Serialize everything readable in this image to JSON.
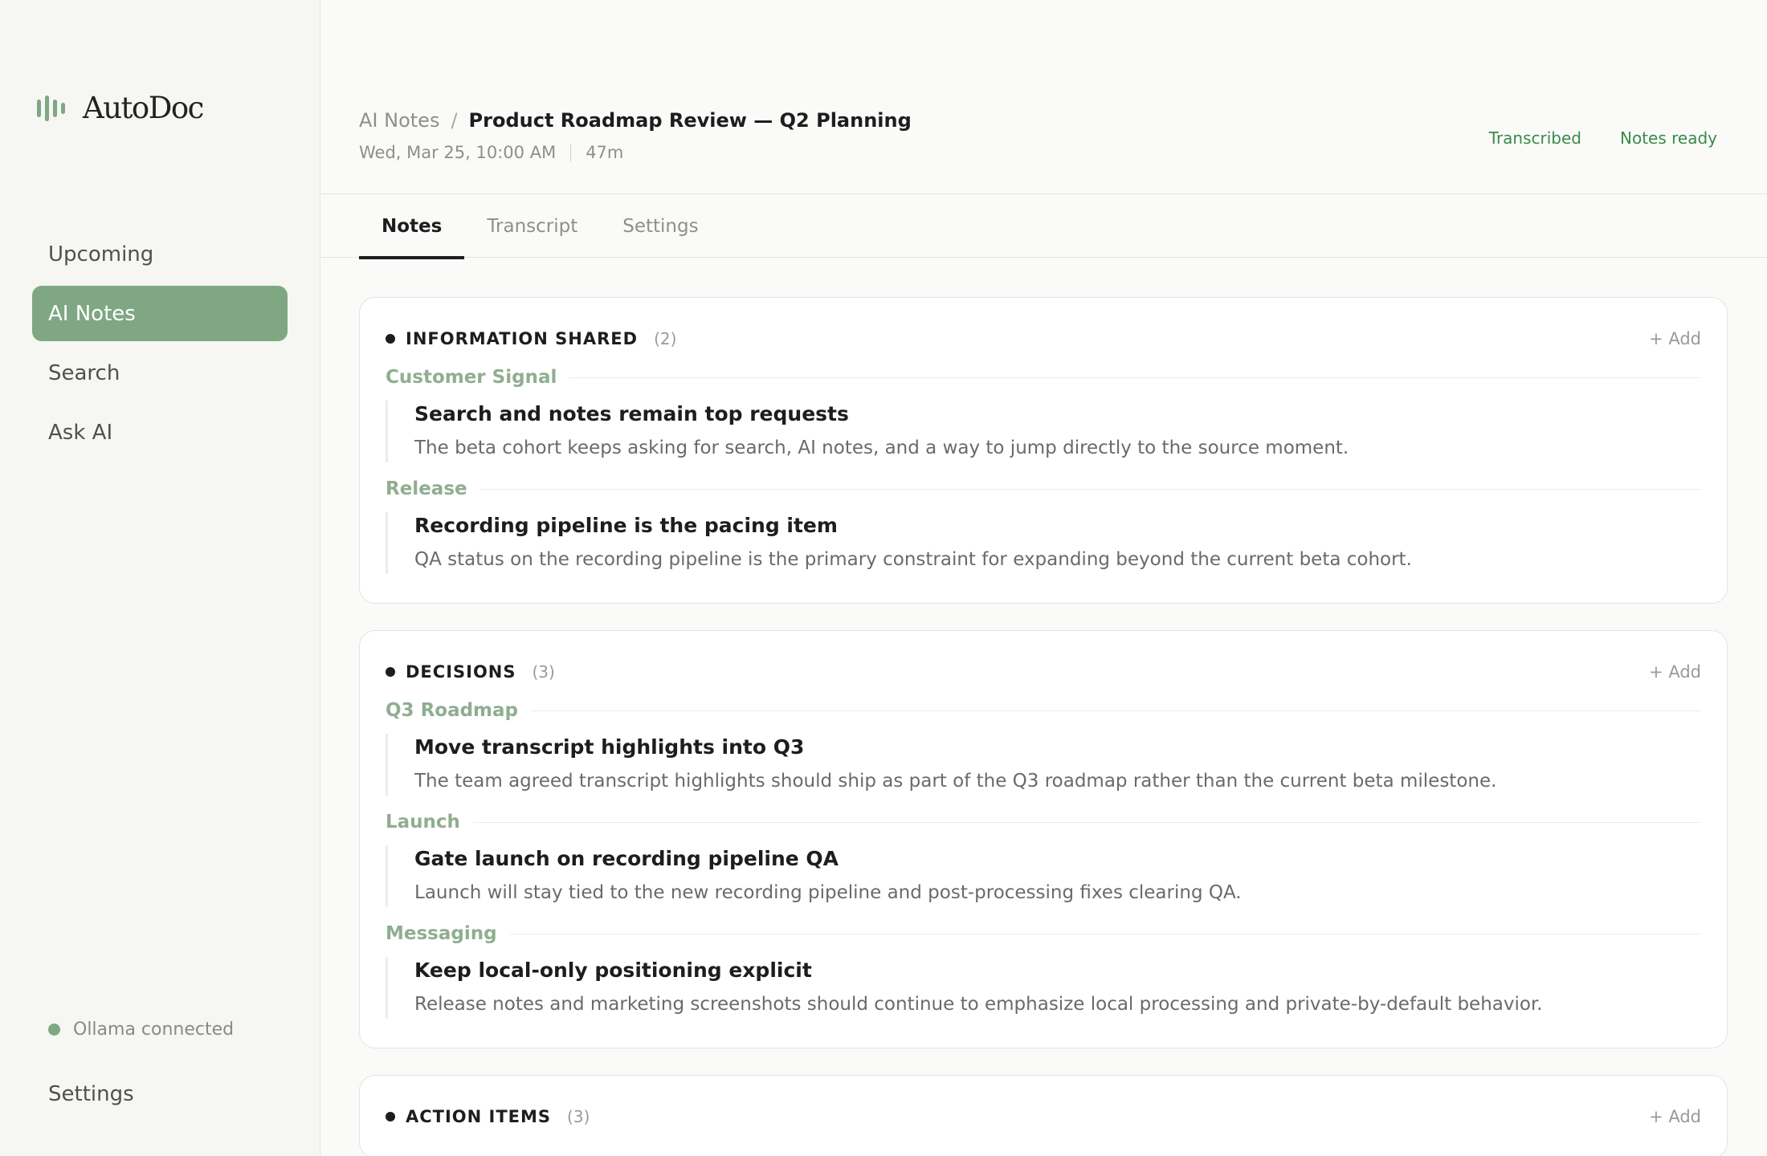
{
  "sidebar": {
    "brand": "AutoDoc",
    "items": [
      {
        "label": "Upcoming"
      },
      {
        "label": "AI Notes"
      },
      {
        "label": "Search"
      },
      {
        "label": "Ask AI"
      }
    ],
    "status": "Ollama connected",
    "settings": "Settings"
  },
  "header": {
    "breadcrumb_parent": "AI Notes",
    "breadcrumb_sep": "/",
    "title": "Product Roadmap Review — Q2 Planning",
    "date": "Wed, Mar 25, 10:00 AM",
    "duration": "47m",
    "badges": [
      "Transcribed",
      "Notes ready"
    ]
  },
  "tabs": [
    {
      "label": "Notes"
    },
    {
      "label": "Transcript"
    },
    {
      "label": "Settings"
    }
  ],
  "sections": [
    {
      "title": "INFORMATION SHARED",
      "count": "(2)",
      "add": "+ Add",
      "groups": [
        {
          "label": "Customer Signal",
          "title": "Search and notes remain top requests",
          "desc": "The beta cohort keeps asking for search, AI notes, and a way to jump directly to the source moment."
        },
        {
          "label": "Release",
          "title": "Recording pipeline is the pacing item",
          "desc": "QA status on the recording pipeline is the primary constraint for expanding beyond the current beta cohort."
        }
      ]
    },
    {
      "title": "DECISIONS",
      "count": "(3)",
      "add": "+ Add",
      "groups": [
        {
          "label": "Q3 Roadmap",
          "title": "Move transcript highlights into Q3",
          "desc": "The team agreed transcript highlights should ship as part of the Q3 roadmap rather than the current beta milestone."
        },
        {
          "label": "Launch",
          "title": "Gate launch on recording pipeline QA",
          "desc": "Launch will stay tied to the new recording pipeline and post-processing fixes clearing QA."
        },
        {
          "label": "Messaging",
          "title": "Keep local-only positioning explicit",
          "desc": "Release notes and marketing screenshots should continue to emphasize local processing and private-by-default behavior."
        }
      ]
    },
    {
      "title": "ACTION ITEMS",
      "count": "(3)",
      "add": "+ Add"
    }
  ],
  "colors": {
    "accent": "#7fa782",
    "badge": "#3a8a4a"
  },
  "icons": {
    "brand": "waveform-icon"
  }
}
